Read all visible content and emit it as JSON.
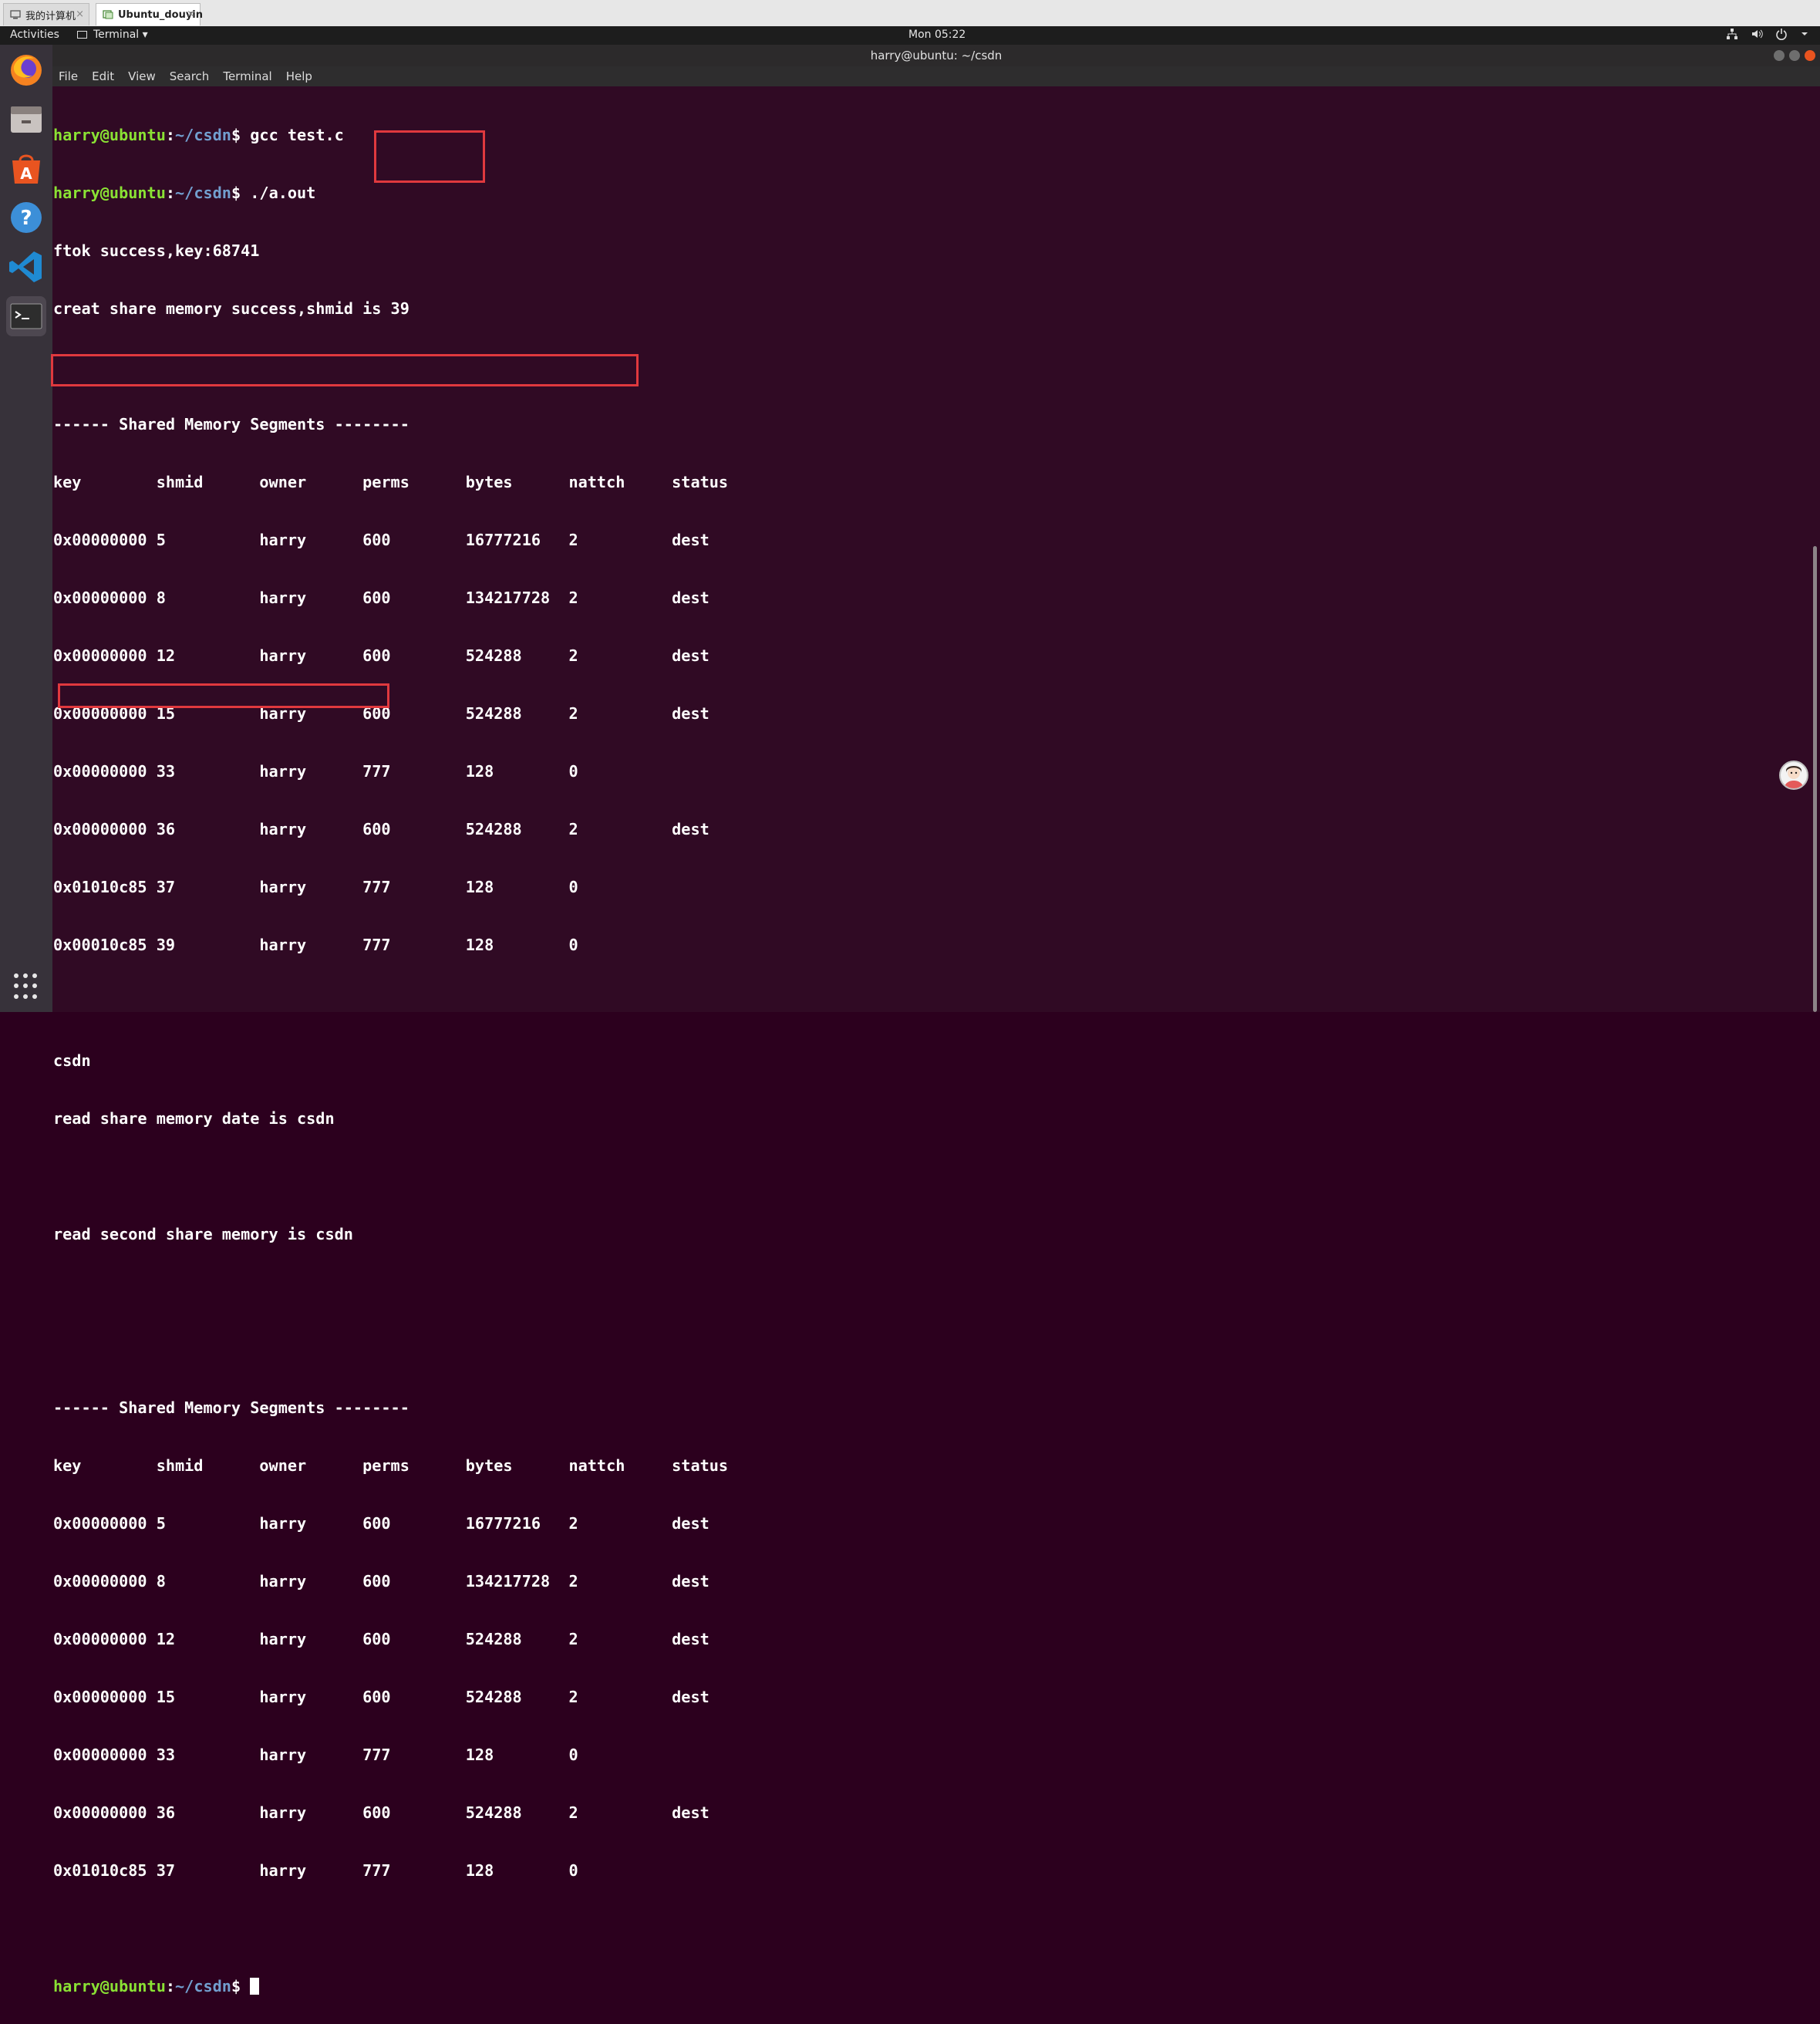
{
  "vm_tabs": [
    {
      "label": "我的计算机",
      "close": "×"
    },
    {
      "label": "Ubuntu_douyin",
      "close": "×"
    }
  ],
  "topbar": {
    "activities": "Activities",
    "app_menu": "Terminal ▾",
    "clock": "Mon 05:22",
    "tray_icons": [
      "network-icon",
      "volume-icon",
      "power-icon",
      "chevron-down-icon"
    ]
  },
  "dock": {
    "items": [
      "firefox-icon",
      "files-icon",
      "software-center-icon",
      "help-icon",
      "vscode-icon",
      "terminal-icon"
    ],
    "show_apps": "apps-grid-icon"
  },
  "window": {
    "title": "harry@ubuntu: ~/csdn",
    "menu": [
      "File",
      "Edit",
      "View",
      "Search",
      "Terminal",
      "Help"
    ]
  },
  "terminal": {
    "prompt_user": "harry@ubuntu",
    "prompt_path": "~/csdn",
    "prompt_sym": "$",
    "cmd1": " gcc test.c",
    "cmd2": " ./a.out",
    "out_ftok": "ftok success,key:68741",
    "out_creat_prefix": "creat share memory success,shmid is ",
    "out_creat_value": "39",
    "seg_header": "------ Shared Memory Segments --------",
    "table_columns": "key        shmid      owner      perms      bytes      nattch     status",
    "table1_rows": [
      "0x00000000 5          harry      600        16777216   2          dest",
      "0x00000000 8          harry      600        134217728  2          dest",
      "0x00000000 12         harry      600        524288     2          dest",
      "0x00000000 15         harry      600        524288     2          dest",
      "0x00000000 33         harry      777        128        0",
      "0x00000000 36         harry      600        524288     2          dest",
      "0x01010c85 37         harry      777        128        0",
      "0x00010c85 39         harry      777        128        0"
    ],
    "out_csdn": "csdn",
    "out_read1": "read share memory date is csdn",
    "out_read2": "read second share memory is csdn",
    "table2_rows": [
      "0x00000000 5          harry      600        16777216   2          dest",
      "0x00000000 8          harry      600        134217728  2          dest",
      "0x00000000 12         harry      600        524288     2          dest",
      "0x00000000 15         harry      600        524288     2          dest",
      "0x00000000 33         harry      777        128        0",
      "0x00000000 36         harry      600        524288     2          dest",
      "0x01010c85 37         harry      777        128        0"
    ]
  },
  "colors": {
    "terminal_bg": "#300a24",
    "prompt_user": "#8ae234",
    "prompt_path": "#729fcf",
    "highlight_box": "#e0393e"
  }
}
